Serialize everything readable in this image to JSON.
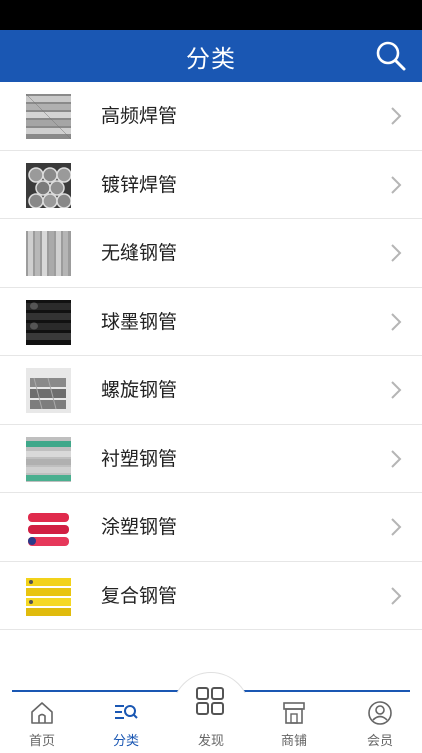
{
  "header": {
    "title": "分类",
    "search_icon": "search-icon"
  },
  "categories": [
    {
      "label": "高频焊管",
      "thumb": "straight-pipes"
    },
    {
      "label": "镀锌焊管",
      "thumb": "pipe-ends"
    },
    {
      "label": "无缝钢管",
      "thumb": "straight-pipes"
    },
    {
      "label": "球墨钢管",
      "thumb": "black-pipes"
    },
    {
      "label": "螺旋钢管",
      "thumb": "spiral-pipes"
    },
    {
      "label": "衬塑钢管",
      "thumb": "lined-pipes"
    },
    {
      "label": "涂塑钢管",
      "thumb": "red-pipes"
    },
    {
      "label": "复合钢管",
      "thumb": "yellow-pipes"
    }
  ],
  "tabbar": {
    "home": "首页",
    "category": "分类",
    "discover": "发现",
    "shop": "商铺",
    "member": "会员"
  },
  "colors": {
    "brand": "#1a57b3",
    "active_tab": "#1a57b3"
  }
}
